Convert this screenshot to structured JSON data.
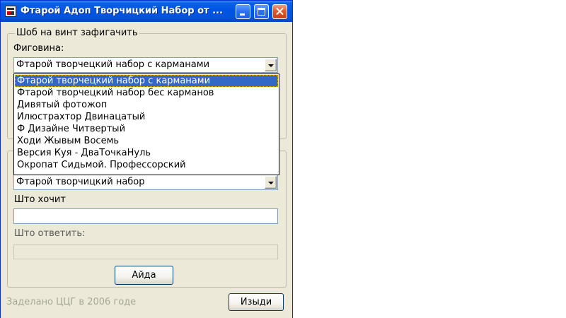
{
  "window": {
    "title": "Фтарой Адоп Творчицкий Набор от ..."
  },
  "group1": {
    "legend": "Шоб на винт зафигачить",
    "field_label": "Фиговина:",
    "selected_value": "Фтарой творчецкий набор с карманами",
    "dropdown_options": [
      "Фтарой творчецкий набор с карманами",
      "Фтарой творчецкий набор бес карманов",
      "Дивятый фотожоп",
      "Илюстрахтор Двинацатый",
      "Ф Дизайне Читвертый",
      "Ходи Жывым Восемь",
      "Версия Куя - ДваТочкаНуль",
      "Окропат Сидьмой. Профессорский"
    ],
    "highlighted_index": 0
  },
  "group2": {
    "combo_value": "Фтарой творчицкий набор",
    "want_label": "Што хочит",
    "want_value": "",
    "answer_label": "Што ответить:",
    "answer_value": "",
    "go_button": "Айда"
  },
  "footer": {
    "credit": "Заделано ЦЦГ в 2006 годе",
    "exit_button": "Изыди"
  },
  "colors": {
    "titlebar": "#0055e5",
    "face": "#ece9d8",
    "selection": "#316ac5",
    "disabled_text": "#a7a693"
  },
  "icons": {
    "app": "app-window-icon",
    "minimize": "minimize-icon",
    "maximize": "maximize-icon",
    "close": "close-icon",
    "dropdown": "chevron-down-icon"
  }
}
